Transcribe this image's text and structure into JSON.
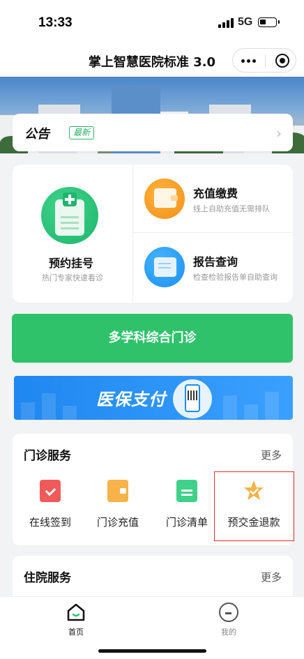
{
  "status": {
    "time": "13:33",
    "network": "5G"
  },
  "navbar": {
    "title": "掌上智慧医院标准 3.0",
    "more_icon": "more-dots-icon",
    "close_icon": "target-icon"
  },
  "notice": {
    "label": "公告",
    "badge": "最新"
  },
  "quick": {
    "appointment": {
      "title": "预约挂号",
      "subtitle": "热门专家快速看诊"
    },
    "recharge": {
      "title": "充值缴费",
      "subtitle": "线上自助充值无需排队"
    },
    "report": {
      "title": "报告查询",
      "subtitle": "检查检验报告单自助查询"
    }
  },
  "multi_dept_button": "多学科综合门诊",
  "pay_banner": {
    "text": "医保支付"
  },
  "outpatient": {
    "title": "门诊服务",
    "more": "更多",
    "items": [
      {
        "label": "在线签到",
        "icon": "checkin-icon"
      },
      {
        "label": "门诊充值",
        "icon": "wallet-icon"
      },
      {
        "label": "门诊清单",
        "icon": "list-icon"
      },
      {
        "label": "预交金退款",
        "icon": "star-icon"
      }
    ]
  },
  "inpatient": {
    "title": "住院服务",
    "more": "更多"
  },
  "tabbar": {
    "home": "首页",
    "me": "我的"
  },
  "colors": {
    "green": "#2fc26b",
    "active_tab": "#111111",
    "inactive_tab": "#888888"
  }
}
